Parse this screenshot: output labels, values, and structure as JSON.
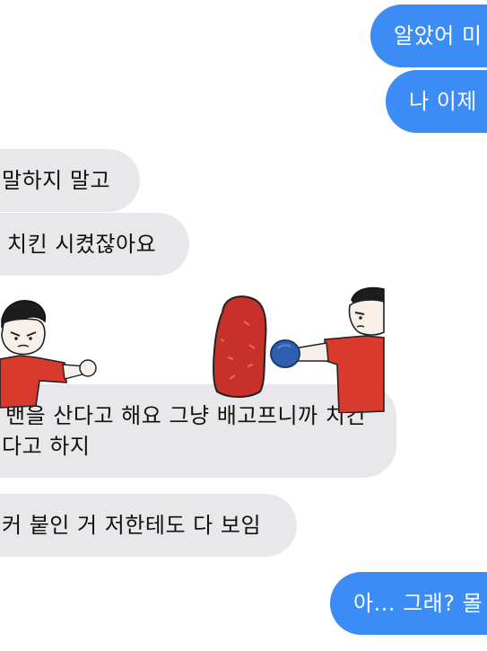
{
  "messages": [
    {
      "id": "m1",
      "direction": "sent",
      "lines": [
        "알았어 미"
      ]
    },
    {
      "id": "m2",
      "direction": "sent",
      "lines": [
        "나 이제"
      ]
    },
    {
      "id": "m3",
      "direction": "received",
      "lines": [
        "말하지 말고"
      ]
    },
    {
      "id": "m4",
      "direction": "received",
      "lines": [
        "치킨 시켰잖아요"
      ]
    },
    {
      "id": "m5",
      "direction": "received",
      "lines": [
        "밴을 산다고 해요 그냥 배고프니까 치킨",
        "다고 하지"
      ]
    },
    {
      "id": "m6",
      "direction": "received",
      "lines": [
        "커 붙인 거 저한테도 다 보임"
      ]
    },
    {
      "id": "m7",
      "direction": "sent",
      "lines": [
        "아... 그래? 몰"
      ]
    }
  ],
  "stickers": [
    {
      "id": "left-boy",
      "icon": "punching-boy-icon"
    },
    {
      "id": "right-boxing",
      "icon": "boxing-bag-boy-icon"
    }
  ],
  "colors": {
    "sent_bubble": "#3b8cf5",
    "received_bubble": "#e8e8ea",
    "sticker_red": "#d93a2e",
    "glove_blue": "#2f5fb0"
  }
}
